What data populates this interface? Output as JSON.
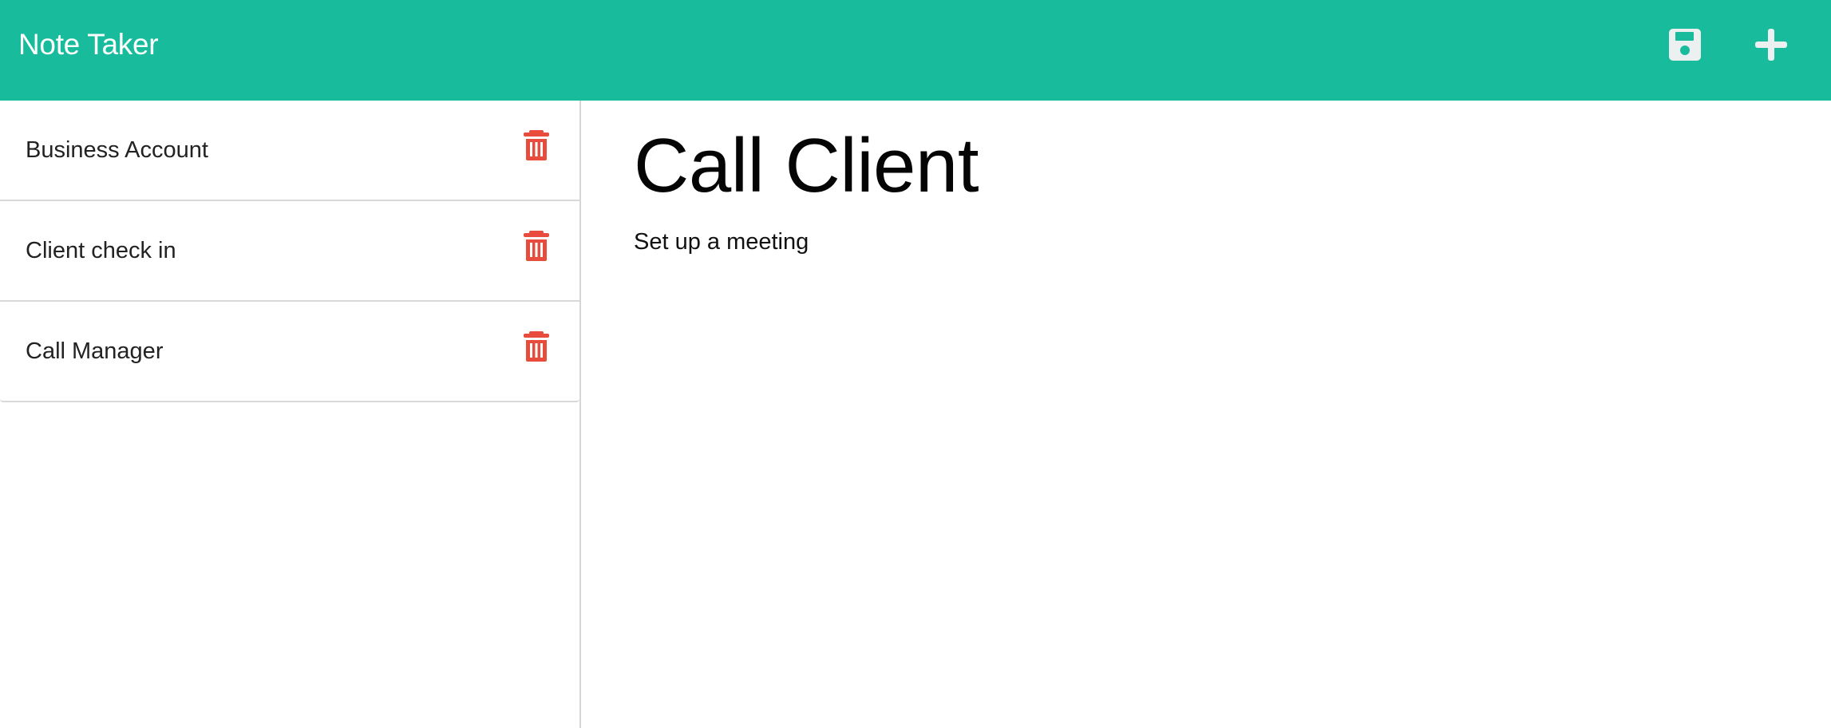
{
  "app": {
    "title": "Note Taker",
    "colors": {
      "accent": "#18bc9c",
      "delete": "#e74c3c",
      "icon": "#ecf0f1"
    }
  },
  "header": {
    "icons": [
      "save-icon",
      "plus-icon"
    ]
  },
  "sidebar": {
    "notes": [
      {
        "title": "Business Account",
        "icon": "trash-icon"
      },
      {
        "title": "Client check in",
        "icon": "trash-icon"
      },
      {
        "title": "Call Manager",
        "icon": "trash-icon"
      }
    ]
  },
  "editor": {
    "title": "Call Client",
    "text": "Set up a meeting"
  }
}
